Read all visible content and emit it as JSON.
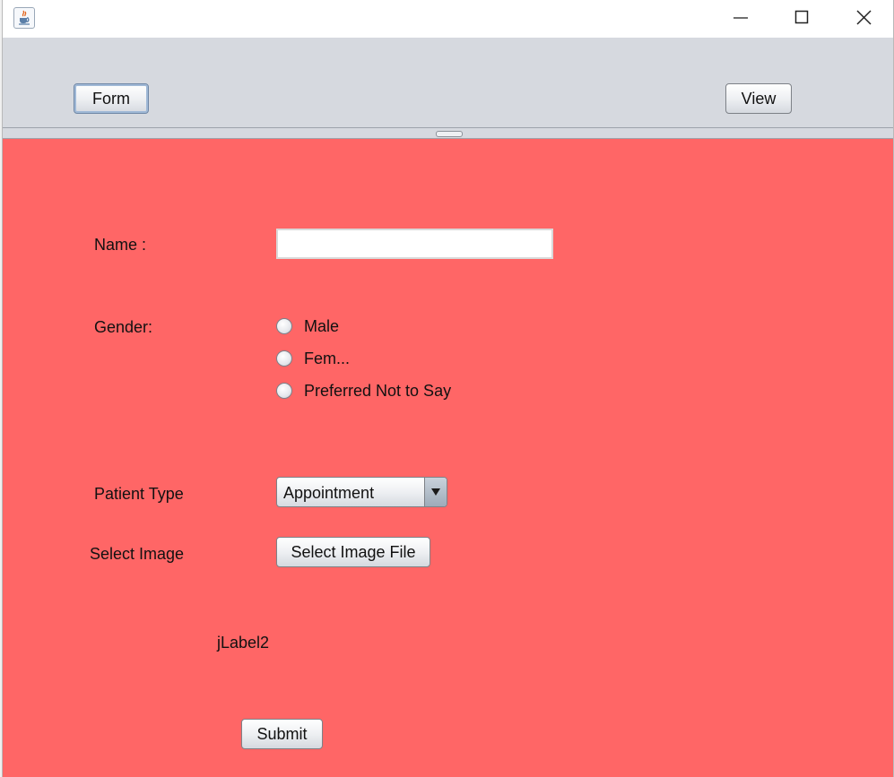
{
  "window": {
    "title": "",
    "controls": {
      "minimize_icon": "minimize-icon",
      "maximize_icon": "maximize-icon",
      "close_icon": "close-icon"
    }
  },
  "toolbar": {
    "form_label": "Form",
    "view_label": "View"
  },
  "form": {
    "name_label": "Name :",
    "name_value": "",
    "gender_label": "Gender:",
    "gender_options": [
      "Male",
      "Fem...",
      "Preferred Not to Say"
    ],
    "patient_type_label": "Patient Type",
    "patient_type_selected": "Appointment",
    "select_image_label": "Select Image",
    "select_image_button": "Select Image File",
    "image_placeholder_label": "jLabel2",
    "submit_label": "Submit"
  },
  "colors": {
    "panel_background": "#ff6666",
    "toolbar_background": "#d6d9df"
  }
}
